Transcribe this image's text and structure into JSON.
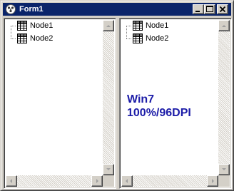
{
  "window": {
    "title": "Form1",
    "icon": "app-icon",
    "buttons": {
      "minimize": "minimize-icon",
      "maximize": "maximize-icon",
      "close": "close-icon"
    }
  },
  "left_tree": {
    "nodes": [
      {
        "label": "Node1",
        "icon": "grid-table-icon"
      },
      {
        "label": "Node2",
        "icon": "grid-table-icon"
      }
    ]
  },
  "right_tree": {
    "nodes": [
      {
        "label": "Node1",
        "icon": "grid-table-icon"
      },
      {
        "label": "Node2",
        "icon": "grid-table-icon"
      }
    ],
    "note_line1": "Win7",
    "note_line2": "100%/96DPI"
  },
  "colors": {
    "title_bar": "#0a246a",
    "face": "#d4d0c8",
    "note_text": "#1c1ca8"
  }
}
